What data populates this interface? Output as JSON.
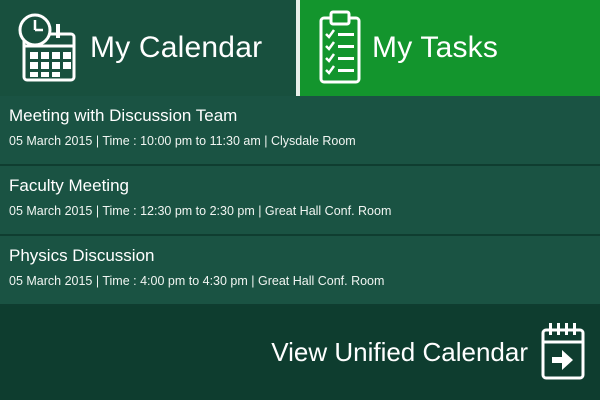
{
  "tabs": {
    "calendar": {
      "label": "My Calendar",
      "icon": "calendar-clock-icon",
      "color": "#18503e"
    },
    "tasks": {
      "label": "My Tasks",
      "icon": "clipboard-checklist-icon",
      "color": "#13952d"
    }
  },
  "events": [
    {
      "title": "Meeting with Discussion Team",
      "meta": "05 March 2015  |  Time : 10:00 pm to 11:30 am  |  Clysdale Room"
    },
    {
      "title": "Faculty Meeting",
      "meta": "05 March 2015  |  Time : 12:30 pm to 2:30 pm  |  Great Hall Conf. Room"
    },
    {
      "title": "Physics Discussion",
      "meta": "05 March 2015  |  Time : 4:00 pm to 4:30 pm  |  Great Hall Conf. Room"
    }
  ],
  "footer": {
    "link_label": "View Unified Calendar",
    "icon": "calendar-arrow-icon"
  }
}
